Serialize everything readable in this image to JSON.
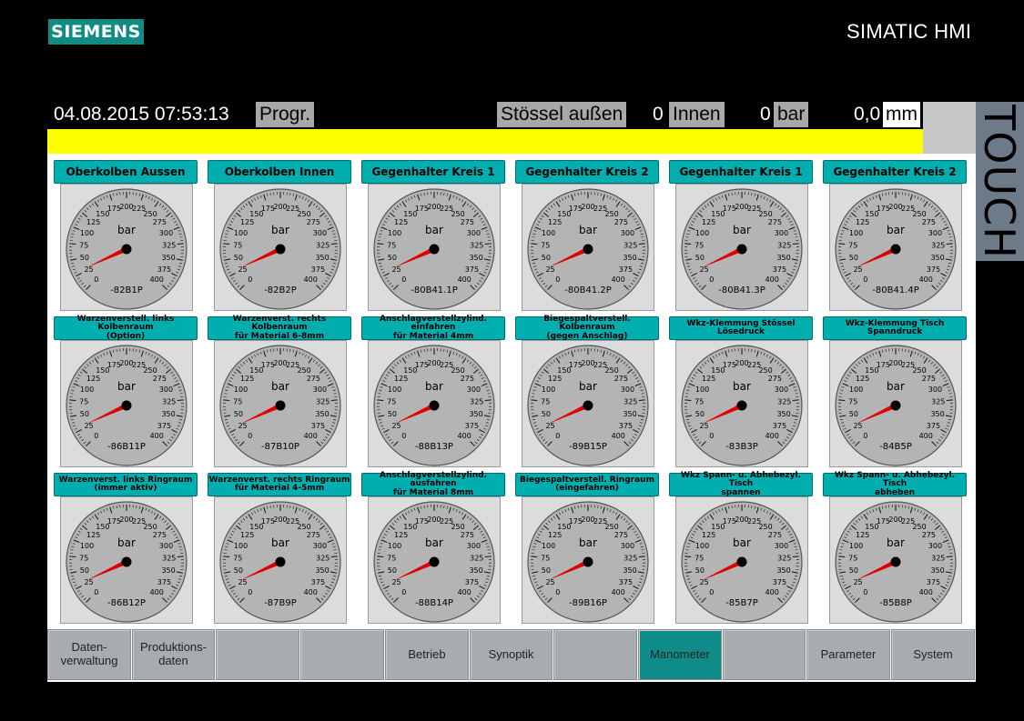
{
  "brand": {
    "logo": "SIEMENS",
    "product": "SIMATIC HMI",
    "touch_label": "TOUCH"
  },
  "status_bar": {
    "datetime": "04.08.2015 07:53:13",
    "mode": "Progr.",
    "ram_state": "Stössel außen",
    "value1": "0",
    "position_label": "Innen",
    "value2": "0",
    "unit1": "bar",
    "value3": "0,0",
    "unit2": "mm"
  },
  "gauges": {
    "unit": "bar",
    "scale_labels": [
      "0",
      "25",
      "50",
      "75",
      "100",
      "125",
      "150",
      "175",
      "200",
      "225",
      "250",
      "275",
      "300",
      "325",
      "350",
      "375",
      "400"
    ],
    "pressure_values": [
      30,
      30,
      30,
      30,
      30,
      30,
      30,
      30,
      30,
      30,
      30,
      30,
      30,
      30,
      30,
      30,
      30,
      30
    ],
    "items": [
      {
        "title": "Oberkolben Aussen",
        "tag": "-82B1P",
        "size": "big"
      },
      {
        "title": "Oberkolben Innen",
        "tag": "-82B2P",
        "size": "big"
      },
      {
        "title": "Gegenhalter Kreis 1",
        "tag": "-80B41.1P",
        "size": "big"
      },
      {
        "title": "Gegenhalter Kreis 2",
        "tag": "-80B41.2P",
        "size": "big"
      },
      {
        "title": "Gegenhalter Kreis 1",
        "tag": "-80B41.3P",
        "size": "big"
      },
      {
        "title": "Gegenhalter Kreis 2",
        "tag": "-80B41.4P",
        "size": "big"
      },
      {
        "title": "Warzenverstell. links Kolbenraum\n(Option)",
        "tag": "-86B11P",
        "size": "small"
      },
      {
        "title": "Warzenverst. rechts Kolbenraum\nfür Material 6-8mm",
        "tag": "-87B10P",
        "size": "small"
      },
      {
        "title": "Anschlagverstellzylind. einfahren\nfür Material 4mm",
        "tag": "-88B13P",
        "size": "small"
      },
      {
        "title": "Biegespaltverstell. Kolbenraum\n(gegen Anschlag)",
        "tag": "-89B15P",
        "size": "small"
      },
      {
        "title": "Wkz-Klemmung Stössel\nLösedruck",
        "tag": "-83B3P",
        "size": "small"
      },
      {
        "title": "Wkz-Klemmung Tisch\nSpanndruck",
        "tag": "-84B5P",
        "size": "small"
      },
      {
        "title": "Warzenverst. links Ringraum\n(immer aktiv)",
        "tag": "-86B12P",
        "size": "small"
      },
      {
        "title": "Warzenverst. rechts Ringraum\nfür Material 4-5mm",
        "tag": "-87B9P",
        "size": "small"
      },
      {
        "title": "Anschlagverstellzylind. ausfahren\nfür Material 8mm",
        "tag": "-88B14P",
        "size": "small"
      },
      {
        "title": "Biegespaltverstell. Ringraum\n(eingefahren)",
        "tag": "-89B16P",
        "size": "small"
      },
      {
        "title": "Wkz Spann- u. Abhebezyl. Tisch\nspannen",
        "tag": "-85B7P",
        "size": "small"
      },
      {
        "title": "Wkz Spann- u. Abhebezyl. Tisch\nabheben",
        "tag": "-85B8P",
        "size": "small"
      }
    ]
  },
  "nav": [
    {
      "label": "Daten-\nverwaltung",
      "active": false
    },
    {
      "label": "Produktions-\ndaten",
      "active": false
    },
    {
      "label": "",
      "active": false
    },
    {
      "label": "",
      "active": false
    },
    {
      "label": "Betrieb",
      "active": false
    },
    {
      "label": "Synoptik",
      "active": false
    },
    {
      "label": "",
      "active": false
    },
    {
      "label": "Manometer",
      "active": true
    },
    {
      "label": "",
      "active": false
    },
    {
      "label": "Parameter",
      "active": false
    },
    {
      "label": "System",
      "active": false
    }
  ],
  "colors": {
    "accent": "#00aeb0",
    "highlight": "#ffff00",
    "needle": "#e00000",
    "nav_active": "#0f8c8a"
  }
}
